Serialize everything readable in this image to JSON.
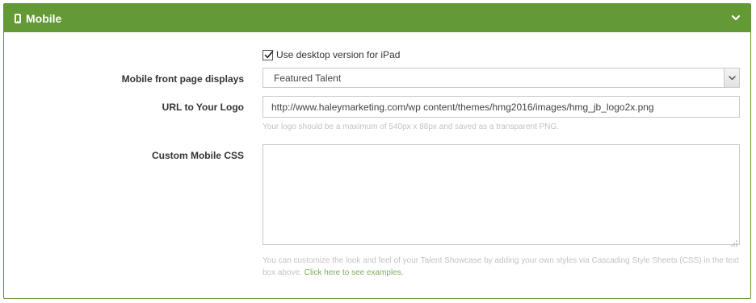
{
  "panel": {
    "title": "Mobile",
    "header_color": "#639a35"
  },
  "desktop_ipad": {
    "checked": true,
    "label": "Use desktop version for iPad"
  },
  "front_page": {
    "label": "Mobile front page displays",
    "selected": "Featured Talent"
  },
  "logo": {
    "label": "URL to Your Logo",
    "value": "http://www.haleymarketing.com/wp content/themes/hmg2016/images/hmg_jb_logo2x.png",
    "help": "Your logo should be a maximum of 540px x 88px and saved as a transparent PNG."
  },
  "custom_css": {
    "label": "Custom Mobile CSS",
    "value": "",
    "help_line1": "You can customize the look and feel of your Talent Showcase by adding your own styles via Cascading Style Sheets (CSS) in the text",
    "help_line2": "box above.",
    "help_link": "Click here to see examples."
  }
}
